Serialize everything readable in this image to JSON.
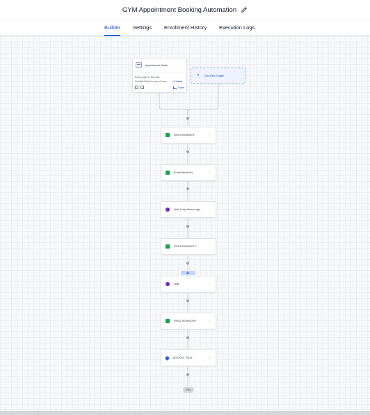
{
  "header": {
    "title": "GYM Appointment Booking Automation",
    "edit_icon": "pencil-icon"
  },
  "tabs": [
    {
      "label": "Builder",
      "active": true
    },
    {
      "label": "Settings",
      "active": false
    },
    {
      "label": "Enrollment History",
      "active": false
    },
    {
      "label": "Execution Logs",
      "active": false
    }
  ],
  "trigger": {
    "icon": "calendar-icon",
    "title": "Appointment Status",
    "filter_1": "Event type is \"Normal\"",
    "filter_2": "Contact Mode is any of 'com...",
    "more": "+ 2 more",
    "stats_label": "Stats"
  },
  "add_trigger": {
    "label": "Add New Trigger"
  },
  "steps": [
    {
      "label": "SMS REMINDER",
      "icon": "sms-icon",
      "color": "#16a34a"
    },
    {
      "label": "Email Reminder",
      "icon": "email-icon",
      "color": "#16a34a"
    },
    {
      "label": "Wait 1 day before appt",
      "icon": "wait-clock-icon",
      "color": "#6d28d9"
    },
    {
      "label": "SMS REMINDER 2",
      "icon": "sms-icon",
      "color": "#16a34a"
    },
    {
      "label": "Wait",
      "icon": "wait-clock-icon",
      "color": "#6d28d9"
    },
    {
      "label": "FINAL REMINDER",
      "icon": "sms-icon",
      "color": "#16a34a"
    },
    {
      "label": "BOOKED TRIAL",
      "icon": "tag-icon",
      "color": "#2563eb"
    }
  ],
  "end_label": "END",
  "colors": {
    "accent": "#2563eb",
    "canvas_bg": "#f7f8fa"
  }
}
